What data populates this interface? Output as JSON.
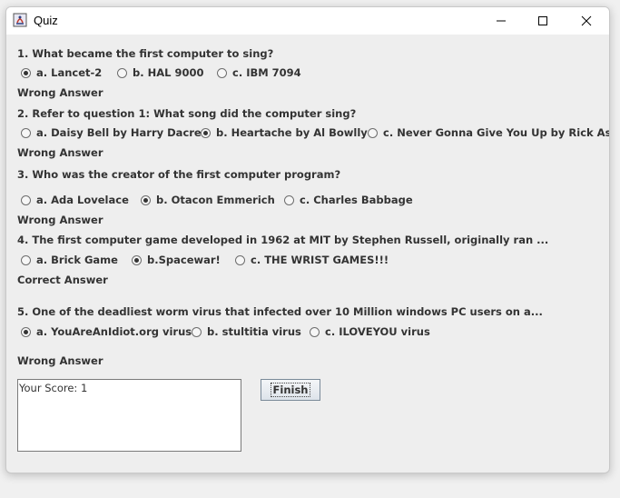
{
  "window": {
    "title": "Quiz"
  },
  "questions": [
    {
      "text": "1. What became the first computer to sing?",
      "options": [
        "a. Lancet-2",
        "b. HAL 9000",
        "c. IBM 7094"
      ],
      "selected": 0,
      "feedback": "Wrong Answer"
    },
    {
      "text": "2. Refer to question 1: What song did the computer sing?",
      "options": [
        "a. Daisy Bell by Harry Dacre",
        "b. Heartache by Al Bowlly",
        "c. Never Gonna Give You Up by Rick Astley"
      ],
      "selected": 1,
      "feedback": "Wrong Answer"
    },
    {
      "text": "3. Who was the creator of the first computer program?",
      "options": [
        "a. Ada Lovelace",
        "b. Otacon Emmerich",
        "c. Charles Babbage"
      ],
      "selected": 1,
      "feedback": "Wrong Answer"
    },
    {
      "text": "4. The first computer game developed in 1962 at MIT by Stephen Russell, originally ran ...",
      "options": [
        "a. Brick Game",
        "b.Spacewar!",
        "c. THE WRIST GAMES!!!"
      ],
      "selected": 1,
      "feedback": "Correct Answer"
    },
    {
      "text": "5. One of the deadliest worm virus that infected over 10 Million windows PC users on a...",
      "options": [
        "a. YouAreAnIdiot.org virus",
        "b. stultitia virus",
        "c. ILOVEYOU virus"
      ],
      "selected": 0,
      "feedback": "Wrong Answer"
    }
  ],
  "score_text": "Your Score: 1",
  "finish_label": "Finish",
  "icons": {
    "app": "java-app-icon",
    "minimize": "minimize-icon",
    "maximize": "maximize-icon",
    "close": "close-icon"
  }
}
